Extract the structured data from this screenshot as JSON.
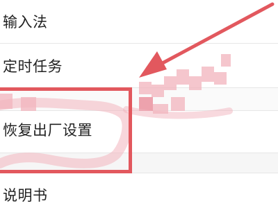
{
  "settings_list": {
    "items": [
      {
        "label": "输入法"
      },
      {
        "label": "定时任务"
      },
      {
        "label": "恢复出厂设置"
      },
      {
        "label": "说明书"
      }
    ]
  },
  "annotation": {
    "highlight_color": "#e2585e",
    "arrow_color": "#e2585e",
    "censor_color": "#f0a8b2"
  }
}
